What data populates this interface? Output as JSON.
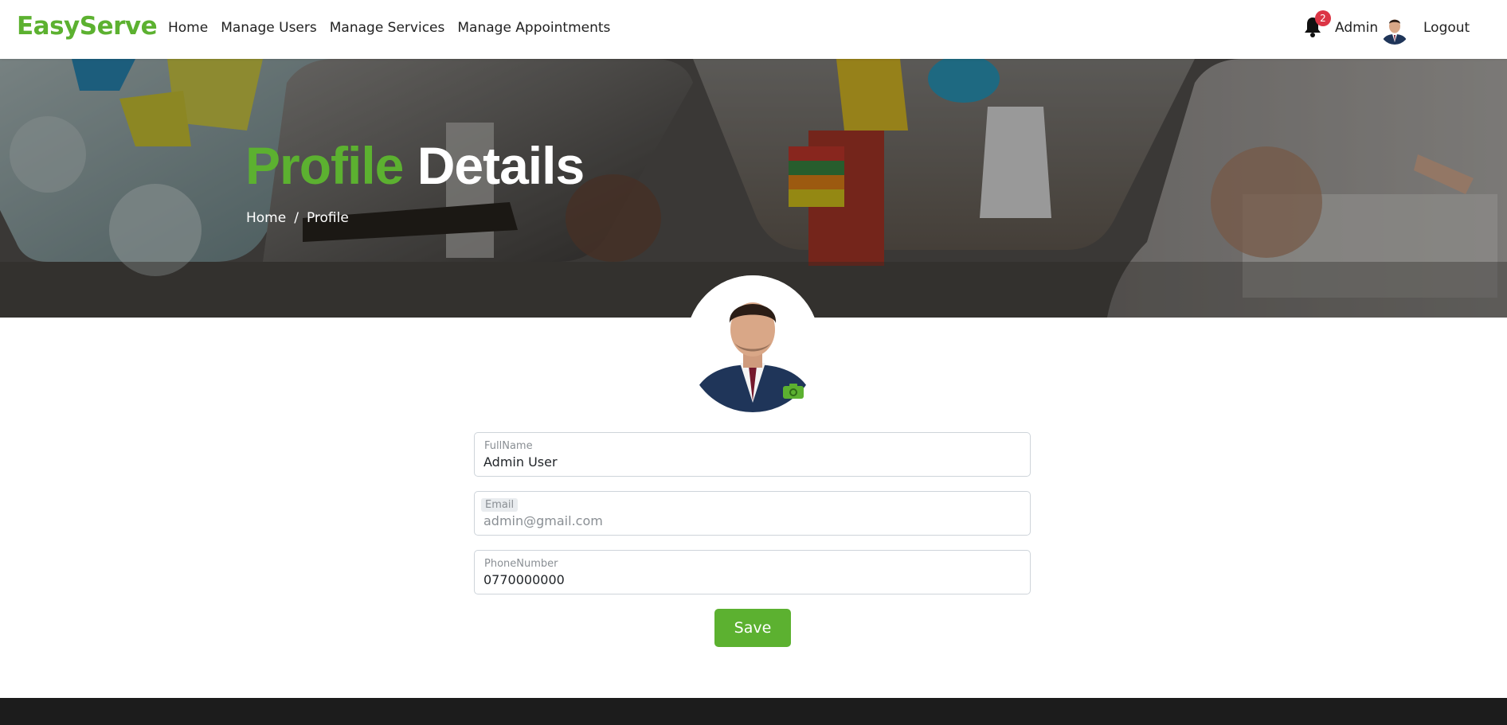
{
  "brand": "EasyServe",
  "nav": {
    "links": [
      "Home",
      "Manage Users",
      "Manage Services",
      "Manage Appointments"
    ],
    "notification_count": "2",
    "user_name": "Admin",
    "logout_label": "Logout"
  },
  "hero": {
    "title_part1": "Profile",
    "title_part2": "Details",
    "breadcrumb_home": "Home",
    "breadcrumb_separator": "/",
    "breadcrumb_current": "Profile"
  },
  "form": {
    "fullname_label": "FullName",
    "fullname_value": "Admin User",
    "email_label": "Email",
    "email_value": "admin@gmail.com",
    "phone_label": "PhoneNumber",
    "phone_value": "0770000000",
    "save_label": "Save"
  },
  "colors": {
    "accent": "#5cb130",
    "badge": "#dc3545",
    "footer": "#1c1c1c"
  },
  "icons": {
    "bell": "bell-icon",
    "camera": "camera-icon"
  }
}
